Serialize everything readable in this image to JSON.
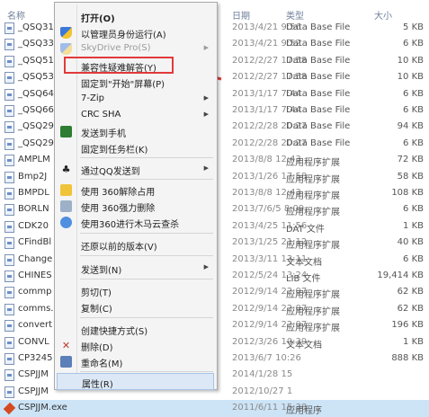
{
  "header": {
    "name": "名称",
    "date": "日期",
    "type": "类型",
    "size": "大小"
  },
  "files": [
    {
      "name": "_QSQ31",
      "date": "2013/4/21 9:56",
      "type": "Data Base File",
      "size": "5 KB"
    },
    {
      "name": "_QSQ33",
      "date": "2013/4/21 9:52",
      "type": "Data Base File",
      "size": "6 KB"
    },
    {
      "name": "_QSQ51",
      "date": "2012/2/27 17:58",
      "type": "Data Base File",
      "size": "10 KB"
    },
    {
      "name": "_QSQ53",
      "date": "2012/2/27 17:58",
      "type": "Data Base File",
      "size": "10 KB"
    },
    {
      "name": "_QSQ64",
      "date": "2013/1/17 7:44",
      "type": "Data Base File",
      "size": "6 KB"
    },
    {
      "name": "_QSQ66",
      "date": "2013/1/17 7:44",
      "type": "Data Base File",
      "size": "6 KB"
    },
    {
      "name": "_QSQ29",
      "date": "2012/2/28 20:27",
      "type": "Data Base File",
      "size": "94 KB"
    },
    {
      "name": "_QSQ29",
      "date": "2012/2/28 20:27",
      "type": "Data Base File",
      "size": "6 KB"
    },
    {
      "name": "AMPLM",
      "date": "2013/8/8 12:43",
      "type": "应用程序扩展",
      "size": "72 KB"
    },
    {
      "name": "Bmp2J",
      "date": "2013/1/26 17:58",
      "type": "应用程序扩展",
      "size": "58 KB"
    },
    {
      "name": "BMPDL",
      "date": "2013/8/8 12:43",
      "type": "应用程序扩展",
      "size": "108 KB"
    },
    {
      "name": "BORLN",
      "date": "2013/7/6/5 8:09",
      "type": "应用程序扩展",
      "size": "6 KB"
    },
    {
      "name": "CDK20",
      "date": "2013/4/25 11:56",
      "type": "DAT 文件",
      "size": "1 KB"
    },
    {
      "name": "CFindBl",
      "date": "2013/1/25 21:12",
      "type": "应用程序扩展",
      "size": "40 KB"
    },
    {
      "name": "Change",
      "date": "2013/3/11 13:11",
      "type": "文本文档",
      "size": "6 KB"
    },
    {
      "name": "CHINES",
      "date": "2012/5/24 13:24",
      "type": "LIB 文件",
      "size": "19,414 KB"
    },
    {
      "name": "commp",
      "date": "2012/9/14 22:07",
      "type": "应用程序扩展",
      "size": "62 KB"
    },
    {
      "name": "comms.",
      "date": "2012/9/14 22:07",
      "type": "应用程序扩展",
      "size": "62 KB"
    },
    {
      "name": "convert",
      "date": "2012/9/14 22:07",
      "type": "应用程序扩展",
      "size": "196 KB"
    },
    {
      "name": "CONVL",
      "date": "2012/3/26 10:39",
      "type": "文本文档",
      "size": "1 KB"
    },
    {
      "name": "CP3245",
      "date": "2013/6/7 10:26",
      "type": "",
      "size": "888 KB"
    },
    {
      "name": "CSPJJM",
      "date": "2014/1/28 15",
      "type": "",
      "size": ""
    },
    {
      "name": "CSPJJM",
      "date": "2012/10/27 1",
      "type": "",
      "size": ""
    },
    {
      "name": "CSPJJM.exe",
      "date": "2011/6/11 15:38",
      "type": "应用程序",
      "size": ""
    }
  ],
  "menu": {
    "open": "打开(O)",
    "run_as_admin": "以管理员身份运行(A)",
    "skydrive": "SkyDrive Pro(S)",
    "compat": "兼容性疑难解答(Y)",
    "pin_start": "固定到\"开始\"屏幕(P)",
    "sevenzip": "7-Zip",
    "crc": "CRC SHA",
    "send_phone": "发送到手机",
    "pin_taskbar": "固定到任务栏(K)",
    "send_qq": "通过QQ发送到",
    "unlock360": "使用 360解除占用",
    "force_delete360": "使用 360强力删除",
    "scan360": "使用360进行木马云查杀",
    "restore": "还原以前的版本(V)",
    "send_to": "发送到(N)",
    "cut": "剪切(T)",
    "copy": "复制(C)",
    "shortcut": "创建快捷方式(S)",
    "delete": "删除(D)",
    "rename": "重命名(M)",
    "properties": "属性(R)"
  },
  "colors": {
    "highlight_box": "#e23a3a",
    "arrow": "#e23a3a",
    "selection": "#cde4f7"
  }
}
